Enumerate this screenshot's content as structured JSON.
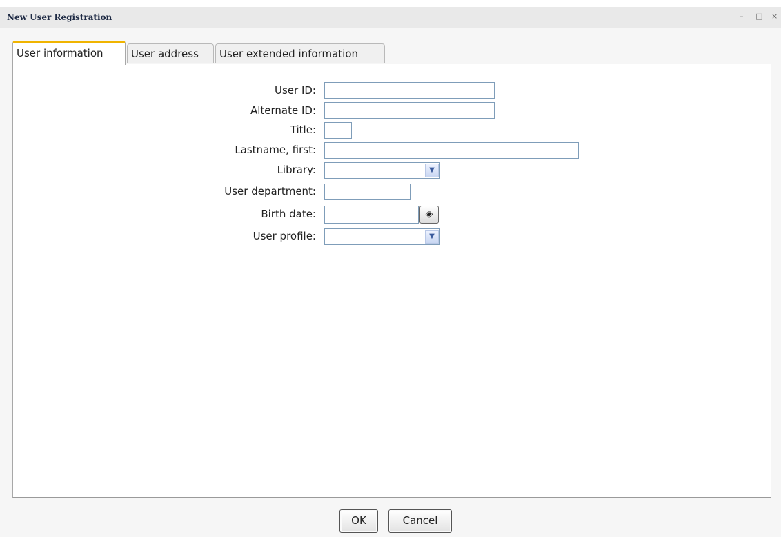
{
  "window": {
    "title": "New User Registration",
    "controls": {
      "minimize": "–",
      "maximize": "□",
      "close": "×"
    }
  },
  "tabs": [
    {
      "label": "User information",
      "active": true
    },
    {
      "label": "User address",
      "active": false
    },
    {
      "label": "User extended information",
      "active": false
    }
  ],
  "form": {
    "user_id": {
      "label": "User ID:",
      "value": ""
    },
    "alternate_id": {
      "label": "Alternate ID:",
      "value": ""
    },
    "title": {
      "label": "Title:",
      "value": ""
    },
    "lastname_first": {
      "label": "Lastname, first:",
      "value": ""
    },
    "library": {
      "label": "Library:",
      "value": "",
      "icon": "chevron-down-icon"
    },
    "user_department": {
      "label": "User department:",
      "value": ""
    },
    "birth_date": {
      "label": "Birth date:",
      "value": "",
      "icon": "calendar-icon"
    },
    "user_profile": {
      "label": "User profile:",
      "value": "",
      "icon": "chevron-down-icon"
    }
  },
  "buttons": {
    "ok": {
      "mnemonic": "O",
      "rest": "K"
    },
    "cancel": {
      "mnemonic": "C",
      "rest": "ancel"
    }
  },
  "colors": {
    "active_tab_accent": "#f0b400",
    "field_border": "#7f9db9"
  }
}
